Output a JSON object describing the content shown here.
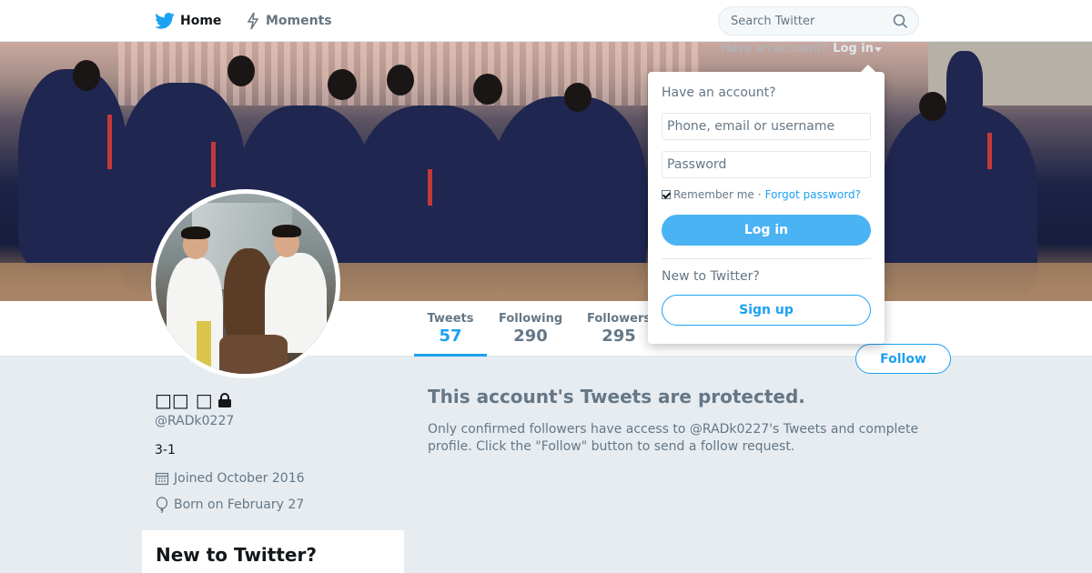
{
  "nav": {
    "home_label": "Home",
    "moments_label": "Moments",
    "search_placeholder": "Search Twitter"
  },
  "banner": {
    "have_account": "Have an account?",
    "login_label": "Log in"
  },
  "profile": {
    "name": "□□ □",
    "handle": "@RADk0227",
    "bio": "3-1",
    "joined": "Joined October 2016",
    "born": "Born on February 27",
    "protected": true
  },
  "stats": {
    "tweets_label": "Tweets",
    "tweets_value": "57",
    "following_label": "Following",
    "following_value": "290",
    "followers_label": "Followers",
    "followers_value": "295"
  },
  "follow_button": "Follow",
  "protected_message": {
    "title": "This account's Tweets are protected.",
    "body": "Only confirmed followers have access to @RADk0227's Tweets and complete profile. Click the \"Follow\" button to send a follow request."
  },
  "new_card": {
    "title": "New to Twitter?"
  },
  "login_dropdown": {
    "title": "Have an account?",
    "username_placeholder": "Phone, email or username",
    "password_placeholder": "Password",
    "remember_label": "Remember me",
    "separator": "·",
    "forgot_label": "Forgot password?",
    "remember_checked": true,
    "login_button": "Log in",
    "new_label": "New to Twitter?",
    "signup_button": "Sign up"
  },
  "colors": {
    "accent": "#1da1f2",
    "background": "#e6ecf0",
    "text_secondary": "#657786"
  },
  "icons": [
    "twitter-bird-icon",
    "lightning-icon",
    "search-icon",
    "lock-icon",
    "calendar-icon",
    "balloon-icon",
    "caret-down-icon"
  ]
}
